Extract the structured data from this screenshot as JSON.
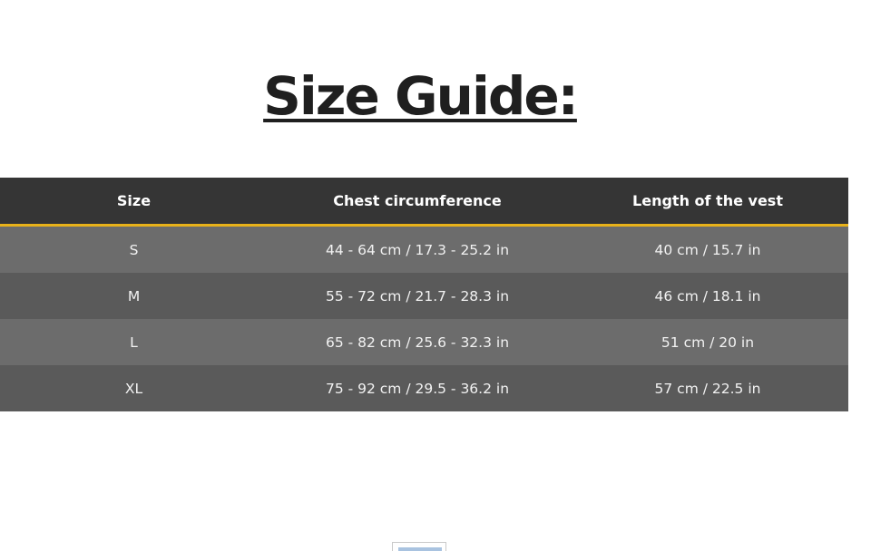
{
  "title": "Size Guide:",
  "table": {
    "headers": [
      "Size",
      "Chest circumference",
      "Length of the vest"
    ],
    "rows": [
      [
        "S",
        "44 - 64 cm / 17.3 - 25.2 in",
        "40 cm / 15.7 in"
      ],
      [
        "M",
        "55 - 72 cm / 21.7 - 28.3 in",
        "46 cm / 18.1 in"
      ],
      [
        "L",
        "65 - 82 cm / 25.6 - 32.3 in",
        "51 cm / 20 in"
      ],
      [
        "XL",
        "75 - 92 cm / 29.5 - 36.2 in",
        "57 cm / 22.5 in"
      ]
    ]
  },
  "colors": {
    "header_bg": "#353535",
    "header_accent_line": "#e8b21a",
    "row_light": "#6c6c6c",
    "row_dark": "#5a5a5a",
    "title_text": "#1f1f1f"
  },
  "icons": {
    "bottom_image": "image-placeholder-icon"
  }
}
